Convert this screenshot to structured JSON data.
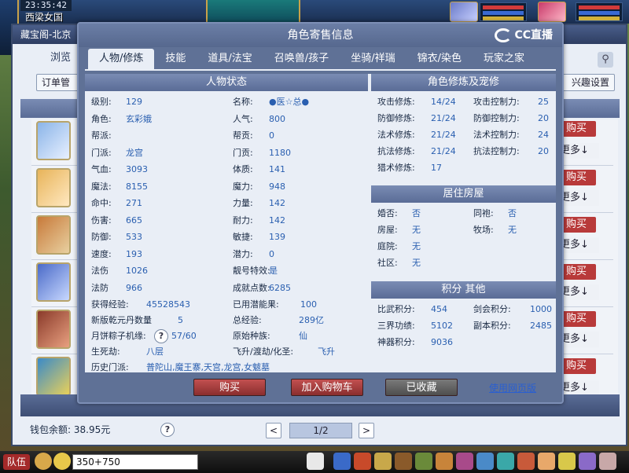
{
  "hud": {
    "time": "23:35:42",
    "location": "西梁女国",
    "coords_value": "350+750",
    "team_label": "队伍"
  },
  "underlying_window": {
    "title": "藏宝阁-北京",
    "tab": "浏览",
    "left_button": "订单管",
    "right_button": "兴趣设置",
    "buy_label": "购买",
    "more_label": "更多↓",
    "wallet_label": "钱包余额:",
    "wallet_value": "38.95元",
    "help": "?",
    "prev": "<",
    "next": ">",
    "page": "1/2"
  },
  "dialog": {
    "title": "角色寄售信息",
    "logo_text": "CC直播",
    "tabs": [
      "人物/修炼",
      "技能",
      "道具/法宝",
      "召唤兽/孩子",
      "坐骑/祥瑞",
      "锦衣/染色",
      "玩家之家"
    ],
    "active_tab": 0,
    "status_title": "人物状态",
    "left_stats": [
      {
        "k": "级别:",
        "v": "129"
      },
      {
        "k": "角色:",
        "v": "玄彩娥"
      },
      {
        "k": "帮派:",
        "v": ""
      },
      {
        "k": "门派:",
        "v": "龙宫"
      },
      {
        "k": "气血:",
        "v": "3093"
      },
      {
        "k": "魔法:",
        "v": "8155"
      },
      {
        "k": "命中:",
        "v": "271"
      },
      {
        "k": "伤害:",
        "v": "665"
      },
      {
        "k": "防御:",
        "v": "533"
      },
      {
        "k": "速度:",
        "v": "193"
      },
      {
        "k": "法伤",
        "v": "1026"
      },
      {
        "k": "法防",
        "v": "966"
      }
    ],
    "mid_stats": [
      {
        "k": "名称:",
        "v": "●医☆总●"
      },
      {
        "k": "人气:",
        "v": "800"
      },
      {
        "k": "帮贡:",
        "v": "0"
      },
      {
        "k": "门贡:",
        "v": "1180"
      },
      {
        "k": "体质:",
        "v": "141"
      },
      {
        "k": "魔力:",
        "v": "948"
      },
      {
        "k": "力量:",
        "v": "142"
      },
      {
        "k": "耐力:",
        "v": "142"
      },
      {
        "k": "敏捷:",
        "v": "139"
      },
      {
        "k": "潜力:",
        "v": "0"
      },
      {
        "k": "靓号特效:",
        "v": "是"
      },
      {
        "k": "成就点数:",
        "v": "6285"
      }
    ],
    "extra_rows": [
      {
        "k": "获得经验:",
        "v": "45528543",
        "k2": "已用潜能果:",
        "v2": "100"
      },
      {
        "k": "新版乾元丹数量",
        "v": "5",
        "k2": "总经验:",
        "v2": "289亿"
      },
      {
        "k": "月饼粽子机缘:",
        "v": "57/60",
        "k2": "原始种族:",
        "v2": "仙"
      },
      {
        "k": "生死劫:",
        "v": "八层",
        "k2": "飞升/渡劫/化圣:",
        "v2": "飞升"
      },
      {
        "k": "历史门派:",
        "v": "普陀山,魔王寨,天宫,龙宫,女魃墓",
        "k2": "",
        "v2": ""
      }
    ],
    "cultivation_title": "角色修炼及宠修",
    "cultivation": [
      {
        "k": "攻击修炼:",
        "v": "14/24",
        "k2": "攻击控制力:",
        "v2": "25"
      },
      {
        "k": "防御修炼:",
        "v": "21/24",
        "k2": "防御控制力:",
        "v2": "20"
      },
      {
        "k": "法术修炼:",
        "v": "21/24",
        "k2": "法术控制力:",
        "v2": "24"
      },
      {
        "k": "抗法修炼:",
        "v": "21/24",
        "k2": "抗法控制力:",
        "v2": "20"
      },
      {
        "k": "猎术修炼:",
        "v": "17",
        "k2": "",
        "v2": ""
      }
    ],
    "house_title": "居住房屋",
    "house": [
      {
        "k": "婚否:",
        "v": "否",
        "k2": "同袍:",
        "v2": "否"
      },
      {
        "k": "房屋:",
        "v": "无",
        "k2": "牧场:",
        "v2": "无"
      },
      {
        "k": "庭院:",
        "v": "无",
        "k2": "",
        "v2": ""
      },
      {
        "k": "社区:",
        "v": "无",
        "k2": "",
        "v2": ""
      }
    ],
    "points_title": "积分 其他",
    "points": [
      {
        "k": "比武积分:",
        "v": "454",
        "k2": "剑会积分:",
        "v2": "1000"
      },
      {
        "k": "三界功绩:",
        "v": "5102",
        "k2": "副本积分:",
        "v2": "2485"
      },
      {
        "k": "神器积分:",
        "v": "9036",
        "k2": "",
        "v2": ""
      }
    ],
    "buttons": {
      "buy": "购买",
      "add_cart": "加入购物车",
      "favorited": "已收藏",
      "web": "使用网页版"
    }
  },
  "colors": {
    "dialog_bg": "#5f7196",
    "content_bg": "#e9eef6",
    "value_blue": "#2a5fb0",
    "buy_red": "#b83a3a"
  }
}
